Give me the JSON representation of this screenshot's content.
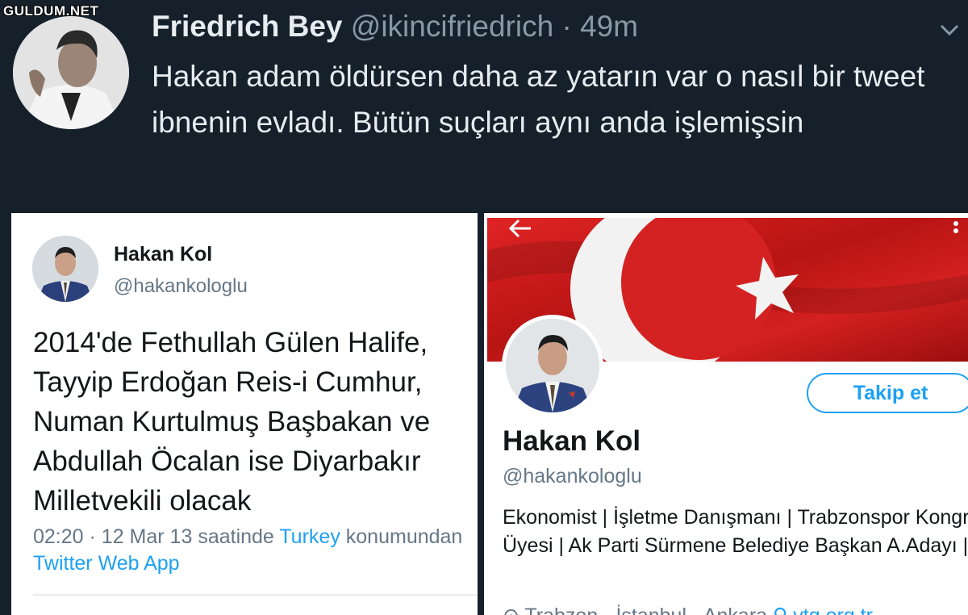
{
  "watermark": "GULDUM.NET",
  "dark_tweet": {
    "name": "Friedrich Bey",
    "handle": "@ikincifriedrich",
    "separator": "·",
    "time": "49m",
    "text": "Hakan adam öldürsen daha az yatarın var o nasıl bir tweet ibnenin evladı. Bütün suçları aynı anda işlemişsin"
  },
  "old_tweet": {
    "name": "Hakan Kol",
    "handle": "@hakankologlu",
    "text": "2014'de Fethullah Gülen Halife, Tayyip Erdoğan Reis-i Cumhur, Numan Kurtulmuş Başbakan ve Abdullah Öcalan ise Diyarbakır Milletvekili olacak",
    "time": "02:20",
    "separator": "·",
    "date": "12 Mar 13",
    "location_prefix": "saatinde",
    "location": "Turkey",
    "location_suffix": "konumundan",
    "source": "Twitter Web App"
  },
  "profile": {
    "name": "Hakan Kol",
    "handle": "@hakankologlu",
    "follow_label": "Takip et",
    "bio": "Ekonomist | İşletme Danışmanı | Trabzonspor Kongre Üyesi | Ak Parti Sürmene Belediye Başkan A.Adayı |",
    "location": "Trabzon - İstanbul - Ankara",
    "website": "vtg.org.tr"
  },
  "colors": {
    "dark_bg": "#15202b",
    "accent_blue": "#1da1f2",
    "flag_red": "#d41f1f"
  }
}
